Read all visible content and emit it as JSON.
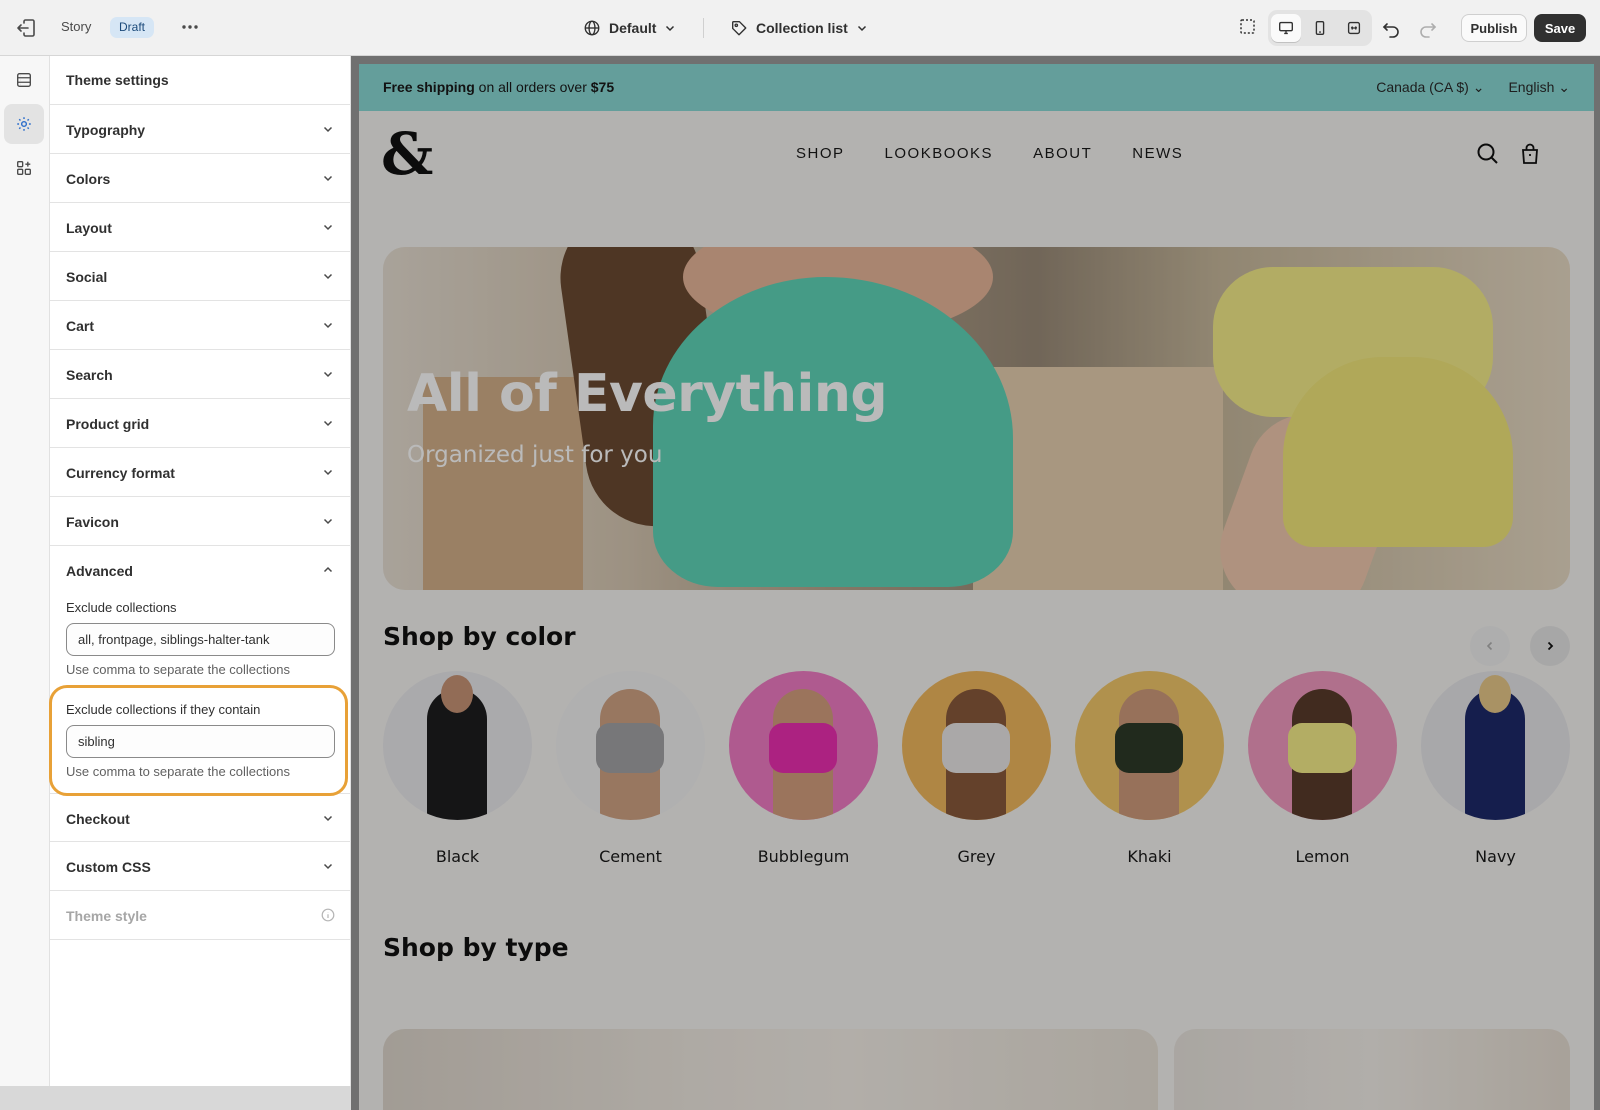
{
  "topbar": {
    "story_label": "Story",
    "draft_badge": "Draft",
    "theme_select": "Default",
    "template_select": "Collection list",
    "publish_label": "Publish",
    "save_label": "Save"
  },
  "panel": {
    "title": "Theme settings",
    "sections": {
      "typography": "Typography",
      "colors": "Colors",
      "layout": "Layout",
      "social": "Social",
      "cart": "Cart",
      "search": "Search",
      "product_grid": "Product grid",
      "currency_format": "Currency format",
      "favicon": "Favicon",
      "advanced": "Advanced",
      "checkout": "Checkout",
      "custom_css": "Custom CSS",
      "theme_style": "Theme style"
    },
    "advanced": {
      "exclude_label": "Exclude collections",
      "exclude_value": "all, frontpage, siblings-halter-tank",
      "exclude_help": "Use comma to separate the collections",
      "contain_label": "Exclude collections if they contain",
      "contain_value": "sibling",
      "contain_help": "Use comma to separate the collections"
    }
  },
  "preview": {
    "announcement": {
      "bold1": "Free shipping",
      "middle": " on all orders over ",
      "bold2": "$75",
      "country": "Canada (CA $)",
      "language": "English"
    },
    "logo": "&",
    "nav": [
      "SHOP",
      "LOOKBOOKS",
      "ABOUT",
      "NEWS"
    ],
    "hero": {
      "title": "All of Everything",
      "subtitle": "Organized just for you"
    },
    "shop_by_color": {
      "title": "Shop by color",
      "swatches": [
        "Black",
        "Cement",
        "Bubblegum",
        "Grey",
        "Khaki",
        "Lemon",
        "Navy"
      ]
    },
    "shop_by_type": {
      "title": "Shop by type"
    }
  },
  "colors": {
    "announcement_bg": "#8ad9d5",
    "highlight_border": "#e8a137",
    "save_bg": "#303030"
  }
}
